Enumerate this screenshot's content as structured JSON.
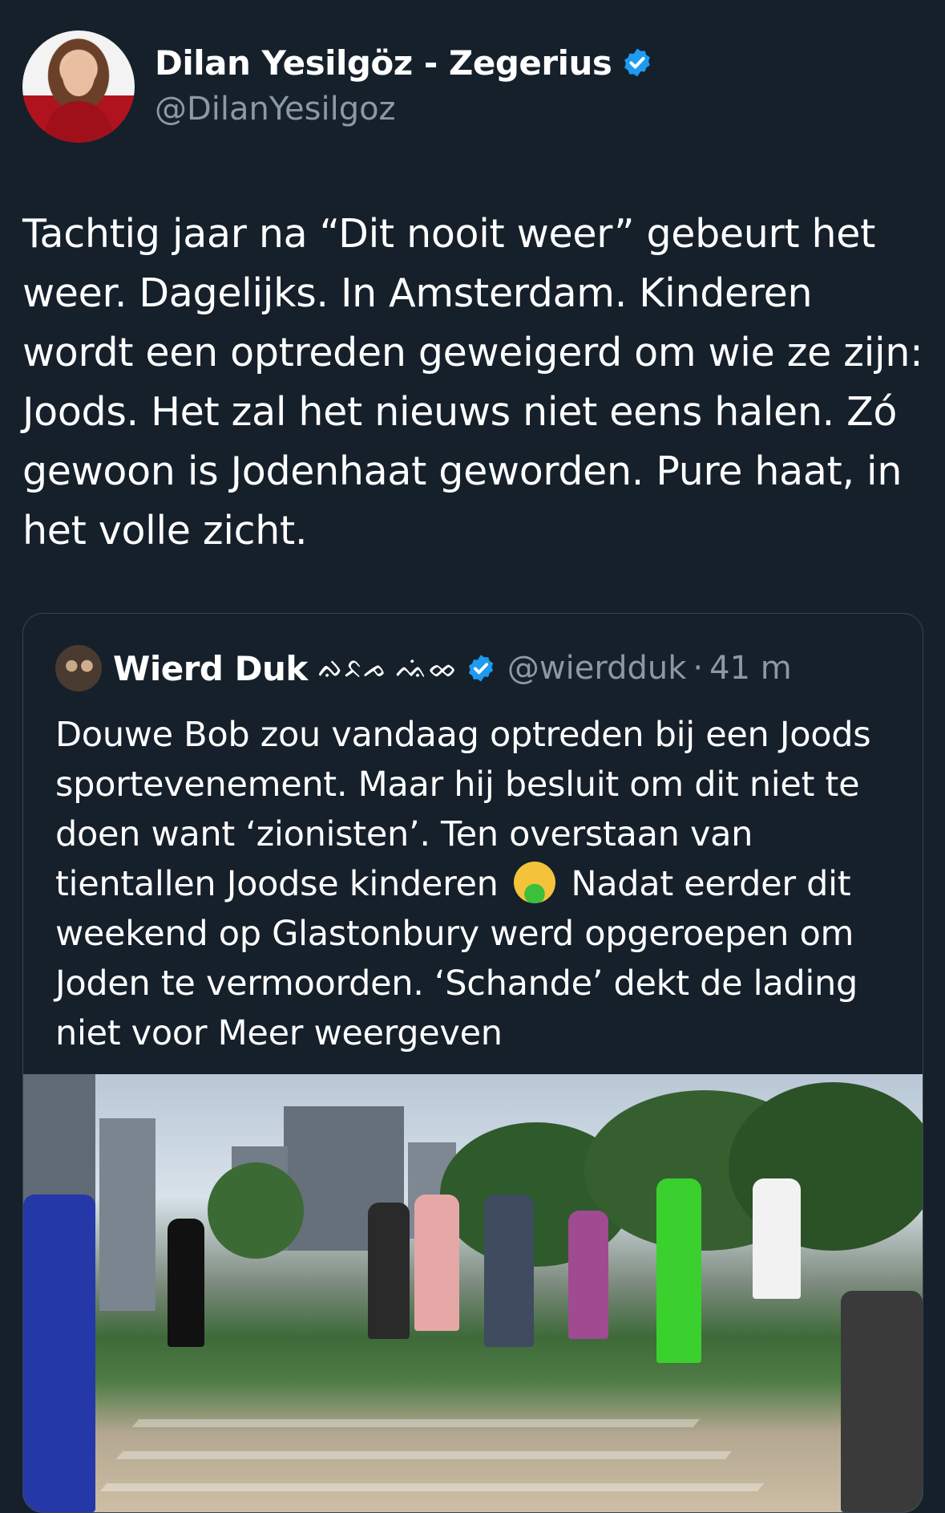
{
  "author": {
    "display_name": "Dilan Yesilgöz - Zegerius",
    "handle": "@DilanYesilgoz",
    "verified": true
  },
  "tweet": {
    "text": "Tachtig jaar na “Dit nooit weer” gebeurt het weer. Dagelijks. In Amsterdam. Kinderen wordt een optreden geweigerd om wie ze zijn: Joods. Het zal het nieuws niet eens halen. Zó gewoon is Jodenhaat geworden. Pure haat, in het volle zicht."
  },
  "quoted": {
    "display_name": "Wierd Duk",
    "name_script": "ᨁᨅᨍ ᨕᨗᨖ",
    "handle": "@wierdduk",
    "separator": "·",
    "time": "41 m",
    "verified": true,
    "text_part1": "Douwe Bob zou vandaag optreden bij een Joods sportevenement. Maar hij besluit om dit niet te doen want ‘zionisten’. Ten overstaan van tientallen Joodse kinderen",
    "emoji": "nauseated-face-emoji",
    "text_part2": " Nadat eerder dit weekend op Glastonbury werd opgeroepen om Joden te vermoorden. ‘Schande’ dekt de lading niet voor",
    "more_link": "Meer weergeven"
  },
  "colors": {
    "background": "#15202b",
    "text": "#ffffff",
    "secondary": "#8b98a5",
    "border": "#38444d",
    "verified": "#1d9bf0"
  }
}
